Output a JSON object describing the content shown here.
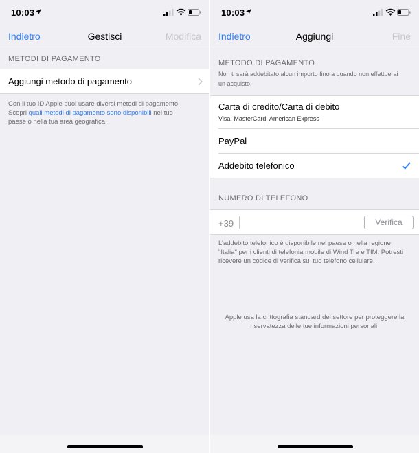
{
  "status": {
    "time": "10:03"
  },
  "left": {
    "nav": {
      "back": "Indietro",
      "title": "Gestisci",
      "action": "Modifica"
    },
    "section_header": "METODI DI PAGAMENTO",
    "add_method": "Aggiungi metodo di pagamento",
    "footer": {
      "text_before": "Con il tuo ID Apple puoi usare diversi metodi di pagamento. Scopri ",
      "link": "quali metodi di pagamento sono disponibili",
      "text_after": " nel tuo paese o nella tua area geografica."
    }
  },
  "right": {
    "nav": {
      "back": "Indietro",
      "title": "Aggiungi",
      "action": "Fine"
    },
    "payment_header": "METODO DI PAGAMENTO",
    "payment_sub": "Non ti sarà addebitato alcun importo fino a quando non effettuerai un acquisto.",
    "methods": [
      {
        "label": "Carta di credito/Carta di debito",
        "sub": "Visa, MasterCard, American Express"
      },
      {
        "label": "PayPal"
      },
      {
        "label": "Addebito telefonico",
        "selected": true
      }
    ],
    "phone_header": "NUMERO DI TELEFONO",
    "phone_prefix": "+39",
    "phone_value": "",
    "verify": "Verifica",
    "phone_note": "L’addebito telefonico è disponibile nel paese o nella regione \"Italia\" per i clienti di telefonia mobile di Wind Tre e TIM. Potresti ricevere un codice di verifica sul tuo telefono cellulare.",
    "security_note": "Apple usa la crittografia standard del settore per proteggere la riservatezza delle tue informazioni personali."
  },
  "colors": {
    "accent": "#2f7cf6",
    "background": "#efeff4",
    "disabled": "#c7c7cc"
  },
  "icons": [
    "location-arrow-icon",
    "cellular-signal-icon",
    "wifi-icon",
    "battery-icon",
    "chevron-right-icon",
    "checkmark-icon"
  ]
}
